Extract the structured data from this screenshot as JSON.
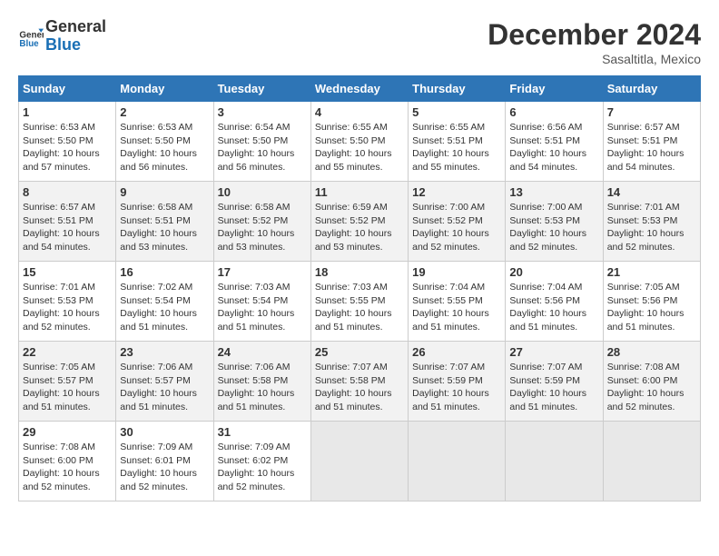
{
  "header": {
    "logo_line1": "General",
    "logo_line2": "Blue",
    "month": "December 2024",
    "location": "Sasaltitla, Mexico"
  },
  "weekdays": [
    "Sunday",
    "Monday",
    "Tuesday",
    "Wednesday",
    "Thursday",
    "Friday",
    "Saturday"
  ],
  "weeks": [
    [
      {
        "day": "1",
        "info": "Sunrise: 6:53 AM\nSunset: 5:50 PM\nDaylight: 10 hours\nand 57 minutes."
      },
      {
        "day": "2",
        "info": "Sunrise: 6:53 AM\nSunset: 5:50 PM\nDaylight: 10 hours\nand 56 minutes."
      },
      {
        "day": "3",
        "info": "Sunrise: 6:54 AM\nSunset: 5:50 PM\nDaylight: 10 hours\nand 56 minutes."
      },
      {
        "day": "4",
        "info": "Sunrise: 6:55 AM\nSunset: 5:50 PM\nDaylight: 10 hours\nand 55 minutes."
      },
      {
        "day": "5",
        "info": "Sunrise: 6:55 AM\nSunset: 5:51 PM\nDaylight: 10 hours\nand 55 minutes."
      },
      {
        "day": "6",
        "info": "Sunrise: 6:56 AM\nSunset: 5:51 PM\nDaylight: 10 hours\nand 54 minutes."
      },
      {
        "day": "7",
        "info": "Sunrise: 6:57 AM\nSunset: 5:51 PM\nDaylight: 10 hours\nand 54 minutes."
      }
    ],
    [
      {
        "day": "8",
        "info": "Sunrise: 6:57 AM\nSunset: 5:51 PM\nDaylight: 10 hours\nand 54 minutes."
      },
      {
        "day": "9",
        "info": "Sunrise: 6:58 AM\nSunset: 5:51 PM\nDaylight: 10 hours\nand 53 minutes."
      },
      {
        "day": "10",
        "info": "Sunrise: 6:58 AM\nSunset: 5:52 PM\nDaylight: 10 hours\nand 53 minutes."
      },
      {
        "day": "11",
        "info": "Sunrise: 6:59 AM\nSunset: 5:52 PM\nDaylight: 10 hours\nand 53 minutes."
      },
      {
        "day": "12",
        "info": "Sunrise: 7:00 AM\nSunset: 5:52 PM\nDaylight: 10 hours\nand 52 minutes."
      },
      {
        "day": "13",
        "info": "Sunrise: 7:00 AM\nSunset: 5:53 PM\nDaylight: 10 hours\nand 52 minutes."
      },
      {
        "day": "14",
        "info": "Sunrise: 7:01 AM\nSunset: 5:53 PM\nDaylight: 10 hours\nand 52 minutes."
      }
    ],
    [
      {
        "day": "15",
        "info": "Sunrise: 7:01 AM\nSunset: 5:53 PM\nDaylight: 10 hours\nand 52 minutes."
      },
      {
        "day": "16",
        "info": "Sunrise: 7:02 AM\nSunset: 5:54 PM\nDaylight: 10 hours\nand 51 minutes."
      },
      {
        "day": "17",
        "info": "Sunrise: 7:03 AM\nSunset: 5:54 PM\nDaylight: 10 hours\nand 51 minutes."
      },
      {
        "day": "18",
        "info": "Sunrise: 7:03 AM\nSunset: 5:55 PM\nDaylight: 10 hours\nand 51 minutes."
      },
      {
        "day": "19",
        "info": "Sunrise: 7:04 AM\nSunset: 5:55 PM\nDaylight: 10 hours\nand 51 minutes."
      },
      {
        "day": "20",
        "info": "Sunrise: 7:04 AM\nSunset: 5:56 PM\nDaylight: 10 hours\nand 51 minutes."
      },
      {
        "day": "21",
        "info": "Sunrise: 7:05 AM\nSunset: 5:56 PM\nDaylight: 10 hours\nand 51 minutes."
      }
    ],
    [
      {
        "day": "22",
        "info": "Sunrise: 7:05 AM\nSunset: 5:57 PM\nDaylight: 10 hours\nand 51 minutes."
      },
      {
        "day": "23",
        "info": "Sunrise: 7:06 AM\nSunset: 5:57 PM\nDaylight: 10 hours\nand 51 minutes."
      },
      {
        "day": "24",
        "info": "Sunrise: 7:06 AM\nSunset: 5:58 PM\nDaylight: 10 hours\nand 51 minutes."
      },
      {
        "day": "25",
        "info": "Sunrise: 7:07 AM\nSunset: 5:58 PM\nDaylight: 10 hours\nand 51 minutes."
      },
      {
        "day": "26",
        "info": "Sunrise: 7:07 AM\nSunset: 5:59 PM\nDaylight: 10 hours\nand 51 minutes."
      },
      {
        "day": "27",
        "info": "Sunrise: 7:07 AM\nSunset: 5:59 PM\nDaylight: 10 hours\nand 51 minutes."
      },
      {
        "day": "28",
        "info": "Sunrise: 7:08 AM\nSunset: 6:00 PM\nDaylight: 10 hours\nand 52 minutes."
      }
    ],
    [
      {
        "day": "29",
        "info": "Sunrise: 7:08 AM\nSunset: 6:00 PM\nDaylight: 10 hours\nand 52 minutes."
      },
      {
        "day": "30",
        "info": "Sunrise: 7:09 AM\nSunset: 6:01 PM\nDaylight: 10 hours\nand 52 minutes."
      },
      {
        "day": "31",
        "info": "Sunrise: 7:09 AM\nSunset: 6:02 PM\nDaylight: 10 hours\nand 52 minutes."
      },
      null,
      null,
      null,
      null
    ]
  ]
}
